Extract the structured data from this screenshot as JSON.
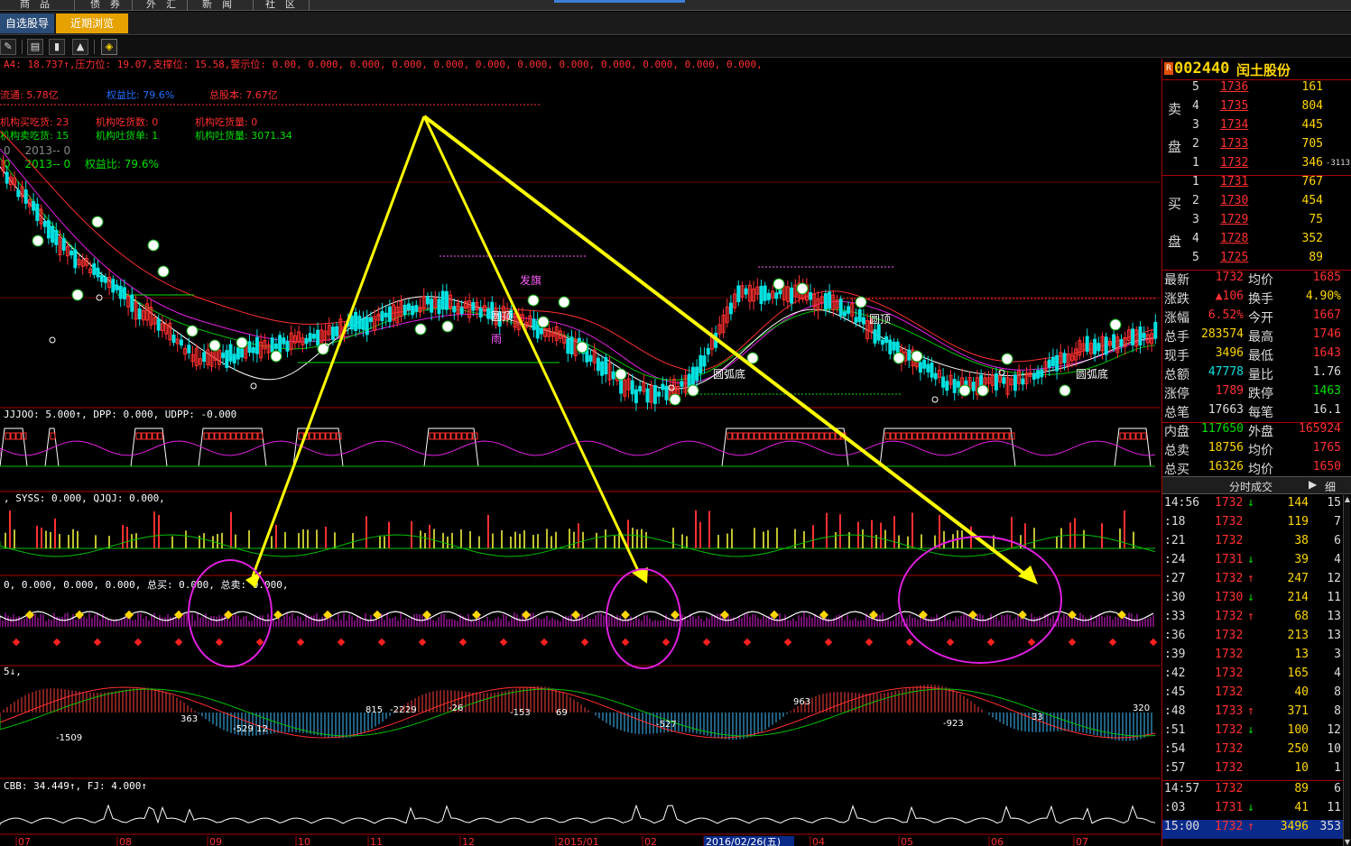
{
  "menu": [
    {
      "label": "商　品"
    },
    {
      "label": "债　券"
    },
    {
      "label": "外　汇"
    },
    {
      "label": "新　闻"
    },
    {
      "label": "社　区"
    }
  ],
  "tabs": {
    "import": "自选股导入",
    "recent": "近期浏览"
  },
  "main_chart": {
    "info_line": "A4: 18.737↑,压力位: 19.07,支撑位: 15.58,警示位: 0.00, 0.000, 0.000, 0.000, 0.000, 0.000, 0.000, 0.000, 0.000, 0.000, 0.000, 0.000,",
    "float_shares": "流通: 5.78亿",
    "equity_ratio_label": "权益比: 79.6%",
    "total_shares": "总股本: 7.67亿",
    "inst_buy_count": "机构买吃货: 23",
    "inst_sell_count": "机构吃货数: 0",
    "inst_buy_vol": "机构吃货量: 0",
    "inst_sell_label": "机构卖吃货: 15",
    "inst_dump_count": "机构吐货单: 1",
    "inst_dump_vol": "机构吐货量: 3071.34",
    "year_line1": "0　 2013-- 0",
    "year_line2": "0　 2013-- 0　 权益比: 79.6%",
    "labels": {
      "fa_qi": "发旗",
      "yu": "雨",
      "yuan_ding": "圆顶",
      "yuan_hu_di_1": "圆弧底",
      "yuan_hu_di_2": "圆弧底",
      "yuan_ding_2": "圆顶"
    }
  },
  "ind1": {
    "title": "JJJOO: 5.000↑, DPP: 0.000, UDPP: -0.000"
  },
  "ind2": {
    "title": ", SYSS: 0.000, QJQJ: 0.000,"
  },
  "ind3": {
    "title": "0, 0.000, 0.000, 0.000, 总买: 0.000, 总卖: 0.000,"
  },
  "ind4": {
    "title": "5↓,",
    "annotations": [
      "-1509",
      "363",
      "-529",
      "12",
      "815",
      "-22",
      "29",
      "-26",
      "-153",
      "69",
      "-527",
      "963",
      "-923",
      "33",
      "320"
    ]
  },
  "ind5": {
    "title": "CBB: 34.449↑, FJ: 4.000↑"
  },
  "xaxis": {
    "labels": [
      "07",
      "08",
      "09",
      "10",
      "11",
      "12",
      "2015/01",
      "02",
      "2016/02/26(五)",
      "04",
      "05",
      "06",
      "07"
    ]
  },
  "stock": {
    "badge": "R",
    "code": "002440",
    "name": "闰土股份"
  },
  "order_book": {
    "sell_label_1": "卖",
    "sell_label_2": "盘",
    "buy_label_1": "买",
    "buy_label_2": "盘",
    "sells": [
      {
        "lvl": "5",
        "price": "1736",
        "vol": "161",
        "ext": ""
      },
      {
        "lvl": "4",
        "price": "1735",
        "vol": "804",
        "ext": ""
      },
      {
        "lvl": "3",
        "price": "1734",
        "vol": "445",
        "ext": ""
      },
      {
        "lvl": "2",
        "price": "1733",
        "vol": "705",
        "ext": ""
      },
      {
        "lvl": "1",
        "price": "1732",
        "vol": "346",
        "ext": "-3113"
      }
    ],
    "buys": [
      {
        "lvl": "1",
        "price": "1731",
        "vol": "767"
      },
      {
        "lvl": "2",
        "price": "1730",
        "vol": "454"
      },
      {
        "lvl": "3",
        "price": "1729",
        "vol": "75"
      },
      {
        "lvl": "4",
        "price": "1728",
        "vol": "352"
      },
      {
        "lvl": "5",
        "price": "1725",
        "vol": "89"
      }
    ]
  },
  "stats": [
    {
      "k1": "最新",
      "v1": "1732",
      "c1": "#ff3030",
      "k2": "均价",
      "v2": "1685",
      "c2": "#ff3030"
    },
    {
      "k1": "涨跌",
      "v1": "▲106",
      "c1": "#ff3030",
      "k2": "换手",
      "v2": "4.90%",
      "c2": "#ffd700"
    },
    {
      "k1": "涨幅",
      "v1": "6.52%",
      "c1": "#ff3030",
      "k2": "今开",
      "v2": "1667",
      "c2": "#ff3030"
    },
    {
      "k1": "总手",
      "v1": "283574",
      "c1": "#ffd700",
      "k2": "最高",
      "v2": "1746",
      "c2": "#ff3030"
    },
    {
      "k1": "现手",
      "v1": "3496",
      "c1": "#ffd700",
      "k2": "最低",
      "v2": "1643",
      "c2": "#ff3030"
    },
    {
      "k1": "总额",
      "v1": "47778",
      "c1": "#00e0e0",
      "k2": "量比",
      "v2": "1.76",
      "c2": "#ddd"
    },
    {
      "k1": "涨停",
      "v1": "1789",
      "c1": "#ff3030",
      "k2": "跌停",
      "v2": "1463",
      "c2": "#00e000"
    },
    {
      "k1": "总笔",
      "v1": "17663",
      "c1": "#ddd",
      "k2": "每笔",
      "v2": "16.1",
      "c2": "#ddd"
    },
    {
      "k1": "内盘",
      "v1": "117650",
      "c1": "#00e000",
      "k2": "外盘",
      "v2": "165924",
      "c2": "#ff3030"
    },
    {
      "k1": "总卖",
      "v1": "18756",
      "c1": "#ffd700",
      "k2": "均价",
      "v2": "1765",
      "c2": "#ff3030"
    },
    {
      "k1": "总买",
      "v1": "16326",
      "c1": "#ffd700",
      "k2": "均价",
      "v2": "1650",
      "c2": "#ff3030"
    }
  ],
  "ticks_header": {
    "title": "分时成交",
    "detail": "细"
  },
  "ticks": [
    {
      "t": "14:56",
      "p": "1732",
      "ar": "↓",
      "ac": "#00e000",
      "v": "144",
      "n": "15"
    },
    {
      "t": ":18",
      "p": "1732",
      "ar": "",
      "ac": "#ddd",
      "v": "119",
      "n": "7"
    },
    {
      "t": ":21",
      "p": "1732",
      "ar": "",
      "ac": "#ddd",
      "v": "38",
      "n": "6"
    },
    {
      "t": ":24",
      "p": "1731",
      "ar": "↓",
      "ac": "#00e000",
      "v": "39",
      "n": "4"
    },
    {
      "t": ":27",
      "p": "1732",
      "ar": "↑",
      "ac": "#ff3030",
      "v": "247",
      "n": "12"
    },
    {
      "t": ":30",
      "p": "1730",
      "ar": "↓",
      "ac": "#00e000",
      "v": "214",
      "n": "11"
    },
    {
      "t": ":33",
      "p": "1732",
      "ar": "↑",
      "ac": "#ff3030",
      "v": "68",
      "n": "13"
    },
    {
      "t": ":36",
      "p": "1732",
      "ar": "",
      "ac": "#ddd",
      "v": "213",
      "n": "13"
    },
    {
      "t": ":39",
      "p": "1732",
      "ar": "",
      "ac": "#ddd",
      "v": "13",
      "n": "3"
    },
    {
      "t": ":42",
      "p": "1732",
      "ar": "",
      "ac": "#ddd",
      "v": "165",
      "n": "4"
    },
    {
      "t": ":45",
      "p": "1732",
      "ar": "",
      "ac": "#ddd",
      "v": "40",
      "n": "8"
    },
    {
      "t": ":48",
      "p": "1733",
      "ar": "↑",
      "ac": "#ff3030",
      "v": "371",
      "n": "8"
    },
    {
      "t": ":51",
      "p": "1732",
      "ar": "↓",
      "ac": "#00e000",
      "v": "100",
      "n": "12"
    },
    {
      "t": ":54",
      "p": "1732",
      "ar": "",
      "ac": "#ddd",
      "v": "250",
      "n": "10"
    },
    {
      "t": ":57",
      "p": "1732",
      "ar": "",
      "ac": "#ddd",
      "v": "10",
      "n": "1"
    },
    {
      "t": "14:57",
      "p": "1732",
      "ar": "",
      "ac": "#ddd",
      "v": "89",
      "n": "6"
    },
    {
      "t": ":03",
      "p": "1731",
      "ar": "↓",
      "ac": "#00e000",
      "v": "41",
      "n": "11"
    },
    {
      "t": "15:00",
      "p": "1732",
      "ar": "↑",
      "ac": "#ff3030",
      "v": "3496",
      "n": "353"
    }
  ],
  "colors": {
    "up": "#ff3030",
    "down": "#00e0e0",
    "accent": "#ffd700",
    "annotation_arrow": "#ffff00",
    "circle": "#e020e0"
  }
}
